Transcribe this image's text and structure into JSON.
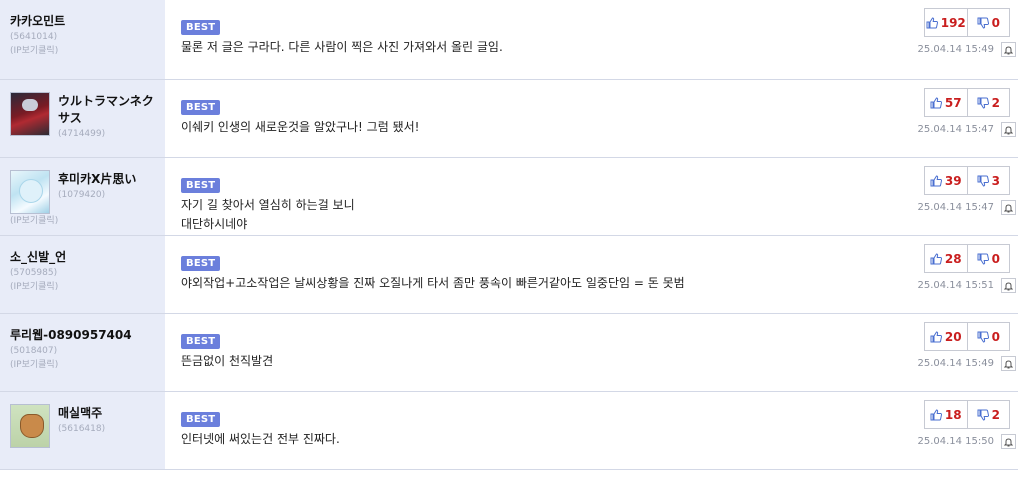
{
  "comments": [
    {
      "nick": "카카오민트",
      "uid": "(5641014)",
      "ip": "(IP보기클릭)",
      "best": "BEST",
      "lines": [
        "물론 저 글은 구라다. 다른 사람이 찍은 사진 가져와서 올린 글임.",
        ""
      ],
      "up": "192",
      "down": "0",
      "time": "25.04.14 15:49",
      "avatar": ""
    },
    {
      "nick": "ウルトラマンネクサス",
      "uid": "(4714499)",
      "ip": "",
      "best": "BEST",
      "lines": [
        "이쉐키 인생의 새로운것을 알았구나! 그럼 됐서!",
        ""
      ],
      "up": "57",
      "down": "2",
      "time": "25.04.14 15:47",
      "avatar": "hero-avatar"
    },
    {
      "nick": "후미카X片思い",
      "uid": "(1079420)",
      "ip": "(IP보기클릭)",
      "best": "BEST",
      "lines": [
        "자기 길 찾아서 열심히 하는걸 보니",
        "대단하시네야"
      ],
      "up": "39",
      "down": "3",
      "time": "25.04.14 15:47",
      "avatar": "ice-avatar"
    },
    {
      "nick": "소_신발_언",
      "uid": "(5705985)",
      "ip": "(IP보기클릭)",
      "best": "BEST",
      "lines": [
        "야외작업+고소작업은 날씨상황을 진짜 오질나게 타서 좀만 풍속이 빠른거같아도 일중단임 = 돈 못범",
        ""
      ],
      "up": "28",
      "down": "0",
      "time": "25.04.14 15:51",
      "avatar": ""
    },
    {
      "nick": "루리웹-0890957404",
      "uid": "(5018407)",
      "ip": "(IP보기클릭)",
      "best": "BEST",
      "lines": [
        "뜬금없이 천직발견",
        ""
      ],
      "up": "20",
      "down": "0",
      "time": "25.04.14 15:49",
      "avatar": ""
    },
    {
      "nick": "매실맥주",
      "uid": "(5616418)",
      "ip": "",
      "best": "BEST",
      "lines": [
        "인터넷에 써있는건 전부 진짜다.",
        ""
      ],
      "up": "18",
      "down": "2",
      "time": "25.04.14 15:50",
      "avatar": "dog-avatar"
    }
  ]
}
